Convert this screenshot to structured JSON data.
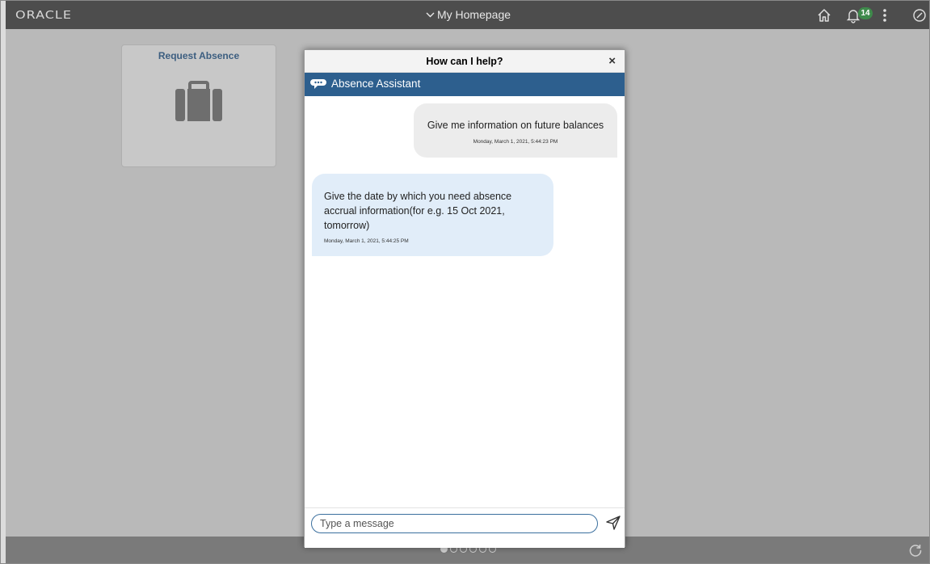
{
  "banner": {
    "logo": "ORACLE",
    "title": "My Homepage",
    "notification_count": "14"
  },
  "tiles": [
    {
      "title": "Request Absence",
      "icon": "briefcase-icon"
    }
  ],
  "dialog": {
    "title": "How can I help?",
    "close_symbol": "×",
    "assistant_name": "Absence Assistant"
  },
  "messages": {
    "user": {
      "text": "Give me information on future balances",
      "timestamp": "Monday, March 1, 2021, 5:44:23 PM"
    },
    "bot": {
      "text": "Give the date by which you need absence accrual information(for e.g. 15 Oct 2021, tomorrow)",
      "timestamp": "Monday, March 1, 2021, 5:44:25 PM"
    }
  },
  "composer": {
    "placeholder": "Type a message",
    "value": ""
  },
  "pager": {
    "page_count": 6,
    "active_page": 1
  },
  "colors": {
    "banner": "#4d4d4d",
    "assistant_bar": "#2d5f8e",
    "bot_bubble": "#e1edf9",
    "user_bubble": "#ececec",
    "badge": "#3e8a4b"
  }
}
